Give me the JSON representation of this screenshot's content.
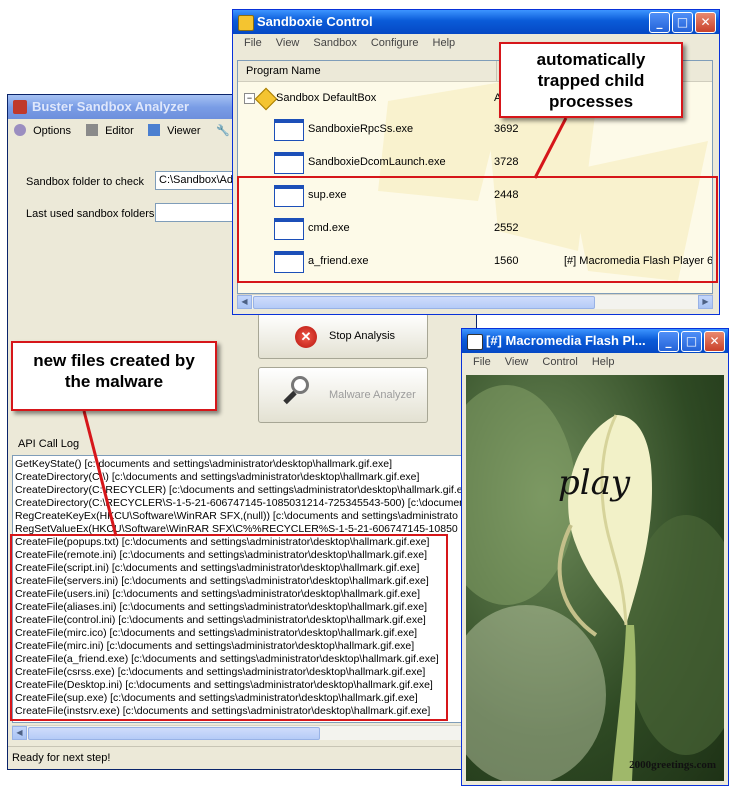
{
  "bsa": {
    "title": "Buster Sandbox Analyzer",
    "menu": [
      "Options",
      "Editor",
      "Viewer"
    ],
    "sandbox_label": "Sandbox folder to check",
    "sandbox_value": "C:\\Sandbox\\Ad",
    "used_label": "Last used sandbox folders",
    "stop_label": "Stop Analysis",
    "malware_label": "Malware Analyzer",
    "log_label": "API Call Log",
    "log_lines": [
      "GetKeyState() [c:\\documents and settings\\administrator\\desktop\\hallmark.gif.exe]",
      "CreateDirectory(C:\\) [c:\\documents and settings\\administrator\\desktop\\hallmark.gif.exe]",
      "CreateDirectory(C:\\RECYCLER) [c:\\documents and settings\\administrator\\desktop\\hallmark.gif.exe]",
      "CreateDirectory(C:\\RECYCLER\\S-1-5-21-606747145-1085031214-725345543-500) [c:\\documents",
      "RegCreateKeyEx(HKCU\\Software\\WinRAR SFX,(null)) [c:\\documents and settings\\administrato",
      "RegSetValueEx(HKCU\\Software\\WinRAR SFX\\C%%RECYCLER%S-1-5-21-606747145-10850",
      "CreateFile(popups.txt) [c:\\documents and settings\\administrator\\desktop\\hallmark.gif.exe]",
      "CreateFile(remote.ini) [c:\\documents and settings\\administrator\\desktop\\hallmark.gif.exe]",
      "CreateFile(script.ini) [c:\\documents and settings\\administrator\\desktop\\hallmark.gif.exe]",
      "CreateFile(servers.ini) [c:\\documents and settings\\administrator\\desktop\\hallmark.gif.exe]",
      "CreateFile(users.ini) [c:\\documents and settings\\administrator\\desktop\\hallmark.gif.exe]",
      "CreateFile(aliases.ini) [c:\\documents and settings\\administrator\\desktop\\hallmark.gif.exe]",
      "CreateFile(control.ini) [c:\\documents and settings\\administrator\\desktop\\hallmark.gif.exe]",
      "CreateFile(mirc.ico) [c:\\documents and settings\\administrator\\desktop\\hallmark.gif.exe]",
      "CreateFile(mirc.ini) [c:\\documents and settings\\administrator\\desktop\\hallmark.gif.exe]",
      "CreateFile(a_friend.exe) [c:\\documents and settings\\administrator\\desktop\\hallmark.gif.exe]",
      "CreateFile(csrss.exe) [c:\\documents and settings\\administrator\\desktop\\hallmark.gif.exe]",
      "CreateFile(Desktop.ini) [c:\\documents and settings\\administrator\\desktop\\hallmark.gif.exe]",
      "CreateFile(sup.exe) [c:\\documents and settings\\administrator\\desktop\\hallmark.gif.exe]",
      "CreateFile(instsrv.exe) [c:\\documents and settings\\administrator\\desktop\\hallmark.gif.exe]"
    ],
    "status": "Ready for next step!"
  },
  "sbc": {
    "title": "Sandboxie Control",
    "menu": [
      "File",
      "View",
      "Sandbox",
      "Configure",
      "Help"
    ],
    "col_program": "Program Name",
    "col_pid": "P",
    "group_label": "Sandbox DefaultBox",
    "group_pid": "A",
    "processes": [
      {
        "name": "SandboxieRpcSs.exe",
        "pid": "3692",
        "title": ""
      },
      {
        "name": "SandboxieDcomLaunch.exe",
        "pid": "3728",
        "title": ""
      },
      {
        "name": "sup.exe",
        "pid": "2448",
        "title": ""
      },
      {
        "name": "cmd.exe",
        "pid": "2552",
        "title": ""
      },
      {
        "name": "a_friend.exe",
        "pid": "1560",
        "title": "[#] Macromedia Flash Player 6 ["
      }
    ]
  },
  "flash": {
    "title": "[#] Macromedia Flash Pl...",
    "menu": [
      "File",
      "View",
      "Control",
      "Help"
    ],
    "play_text": "play",
    "credit": "2000greetings.com"
  },
  "annotations": {
    "trapped": "automatically trapped child processes",
    "newfiles": "new files created by the malware"
  },
  "colors": {
    "accent_red": "#d6161a",
    "xp_blue": "#0a5bd8",
    "list_bg": "#fdfae8"
  }
}
